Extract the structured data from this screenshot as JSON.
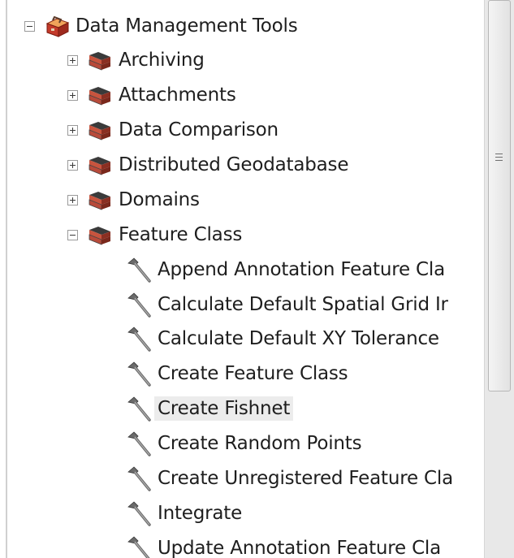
{
  "tree": {
    "root": {
      "label": "Data Management Tools",
      "expanded": true,
      "icon": "red-toolbox-icon"
    },
    "toolsets": [
      {
        "label": "Archiving",
        "expanded": false,
        "icon": "toolset-icon"
      },
      {
        "label": "Attachments",
        "expanded": false,
        "icon": "toolset-icon"
      },
      {
        "label": "Data Comparison",
        "expanded": false,
        "icon": "toolset-icon"
      },
      {
        "label": "Distributed Geodatabase",
        "expanded": false,
        "icon": "toolset-icon"
      },
      {
        "label": "Domains",
        "expanded": false,
        "icon": "toolset-icon"
      },
      {
        "label": "Feature Class",
        "expanded": true,
        "icon": "toolset-icon"
      }
    ],
    "tools": [
      {
        "label": "Append Annotation Feature Cla",
        "icon": "hammer-icon"
      },
      {
        "label": "Calculate Default Spatial Grid Ir",
        "icon": "hammer-icon"
      },
      {
        "label": "Calculate Default XY Tolerance",
        "icon": "hammer-icon"
      },
      {
        "label": "Create Feature Class",
        "icon": "hammer-icon"
      },
      {
        "label": "Create Fishnet",
        "icon": "hammer-icon",
        "selected": true
      },
      {
        "label": "Create Random Points",
        "icon": "hammer-icon"
      },
      {
        "label": "Create Unregistered Feature Cla",
        "icon": "hammer-icon"
      },
      {
        "label": "Integrate",
        "icon": "hammer-icon"
      },
      {
        "label": "Update Annotation Feature Cla",
        "icon": "hammer-icon"
      }
    ]
  },
  "scrollbar": {
    "thumb_grip_icon": "grip-icon"
  },
  "colors": {
    "selection": "#ececec",
    "toolbox": "#c0392b",
    "toolset": "#b84a3a"
  }
}
